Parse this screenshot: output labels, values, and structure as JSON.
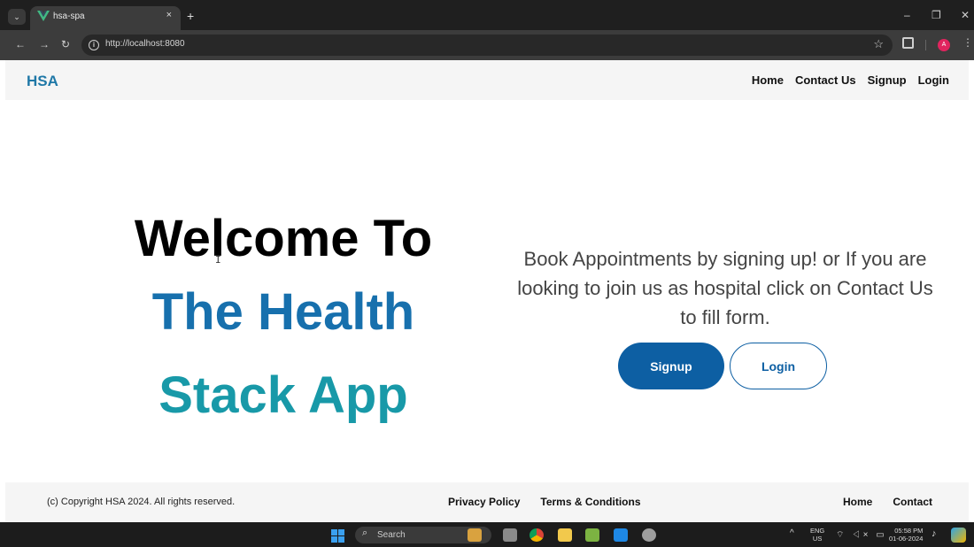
{
  "browser": {
    "tab_title": "hsa-spa",
    "tab_close": "×",
    "new_tab": "+",
    "url": "http://localhost:8080",
    "icons": [
      "tab-search-icon",
      "vue-favicon-icon",
      "back-icon",
      "forward-icon",
      "reload-icon",
      "site-info-icon",
      "bookmark-star-icon",
      "extensions-icon",
      "profile-avatar-icon",
      "menu-icon",
      "minimize-icon",
      "restore-icon",
      "close-window-icon"
    ],
    "profile_initial": "A",
    "profile_color": "#e0245e"
  },
  "site": {
    "brand": "HSA",
    "brand_color": "#1f78a7",
    "nav": [
      "Home",
      "Contact Us",
      "Signup",
      "Login"
    ],
    "hero": {
      "line1": "Welcome To",
      "line2": "The Health",
      "line3": "Stack App",
      "description": "Book Appointments by signing up! or If you are looking to join us as hospital click on Contact Us to fill form.",
      "signup_label": "Signup",
      "login_label": "Login",
      "accent_color": "#0d5fa3"
    },
    "footer": {
      "copyright": "(c) Copyright HSA 2024. All rights reserved.",
      "privacy": "Privacy Policy",
      "terms": "Terms & Conditions",
      "home": "Home",
      "contact": "Contact"
    }
  },
  "taskbar": {
    "search_label": "Search",
    "lang_top": "ENG",
    "lang_bottom": "US",
    "time": "05:58 PM",
    "date": "01-06-2024",
    "apps": [
      "start-icon",
      "search-icon",
      "widgets-icon",
      "task-view-icon",
      "chrome-icon",
      "file-explorer-icon",
      "notepad-icon",
      "vscode-icon",
      "settings-icon"
    ]
  }
}
